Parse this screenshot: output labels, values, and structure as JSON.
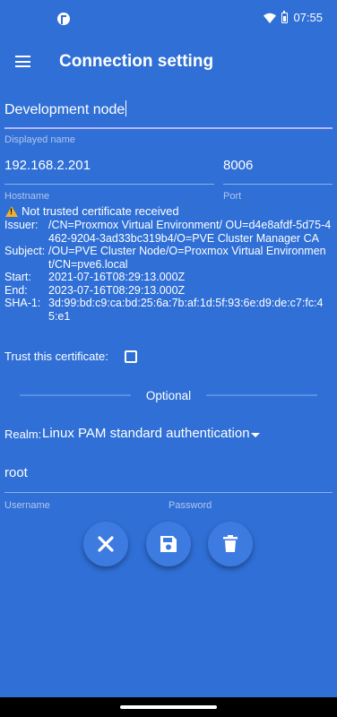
{
  "status_bar": {
    "time": "07:55",
    "icons": [
      "app-notification-icon",
      "wifi-icon",
      "battery-icon"
    ]
  },
  "toolbar": {
    "title": "Connection setting",
    "menu_icon": "menu-icon"
  },
  "form": {
    "node_name": {
      "value": "Development node",
      "hint": "Displayed name"
    },
    "hostname": {
      "value": "192.168.2.201",
      "hint": "Hostname"
    },
    "port": {
      "value": "8006",
      "hint": "Port"
    },
    "certificate": {
      "warning": "Not trusted certificate received",
      "rows": [
        {
          "label": "Issuer:",
          "value": "/CN=Proxmox Virtual Environment/ OU=d4e8afdf-5d75-4462-9204-3ad33bc319b4/O=PVE Cluster Manager CA"
        },
        {
          "label": "Subject:",
          "value": "/OU=PVE Cluster Node/O=Proxmox Virtual Environment/CN=pve6.local"
        },
        {
          "label": "Start:",
          "value": "2021-07-16T08:29:13.000Z"
        },
        {
          "label": "End:",
          "value": "2023-07-16T08:29:13.000Z"
        },
        {
          "label": "SHA-1:",
          "value": "3d:99:bd:c9:ca:bd:25:6a:7b:af:1d:5f:93:6e:d9:de:c7:fc:45:e1"
        }
      ],
      "trust_label": "Trust this certificate:",
      "trust_checked": false
    },
    "optional_label": "Optional",
    "realm": {
      "label": "Realm:",
      "value": "Linux PAM standard authentication"
    },
    "username": {
      "value": "root",
      "hint": "Username"
    },
    "password": {
      "value": "",
      "hint": "Password"
    }
  },
  "actions": {
    "cancel_icon": "close-icon",
    "save_icon": "save-icon",
    "delete_icon": "delete-icon"
  },
  "colors": {
    "background": "#2f6fd6",
    "accent_underline": "#b7b4f7",
    "warning": "#f2b127",
    "fab": "#3e7be0"
  }
}
